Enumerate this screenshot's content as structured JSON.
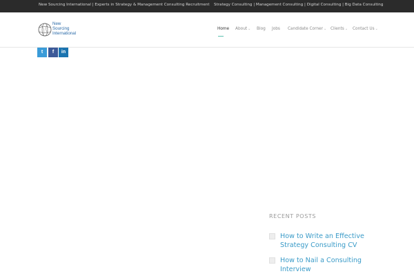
{
  "topbar": {
    "left_text": "New Sourcing International | Experts in Strategy & Management Consulting Recruitment",
    "right_text": "Strategy Consulting | Management Consulting | Digital Consulting | Big Data Consulting"
  },
  "logo": {
    "line1": "New",
    "line2": "Sourcing",
    "line3": "International"
  },
  "nav": {
    "items": [
      {
        "label": "Home",
        "active": true
      },
      {
        "label": "About",
        "dropdown": true
      },
      {
        "label": "Blog"
      },
      {
        "label": "Jobs"
      },
      {
        "label": "Candidate Corner",
        "dropdown": true
      },
      {
        "label": "Clients",
        "dropdown": true
      },
      {
        "label": "Contact Us",
        "dropdown": true
      }
    ],
    "chevron": "⌄"
  },
  "share": {
    "twitter": {
      "glyph": "t",
      "color": "#3a9bd8"
    },
    "facebook": {
      "glyph": "f",
      "color": "#3b5998"
    },
    "linkedin": {
      "glyph": "in",
      "color": "#1b74b0"
    }
  },
  "sidebar": {
    "recent_posts_title": "RECENT POSTS",
    "posts": [
      {
        "title": "How to Write an Effective Strategy Consulting CV"
      },
      {
        "title": "How to Nail a Consulting Interview"
      }
    ]
  },
  "colors": {
    "accent": "#5bbfae",
    "link": "#3a9bc8",
    "topbar_bg": "#2b2b2b"
  }
}
